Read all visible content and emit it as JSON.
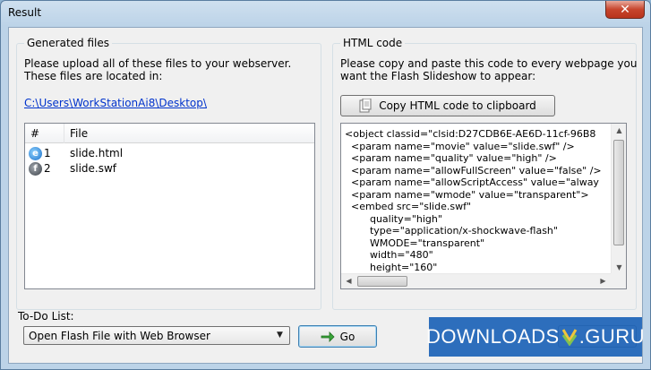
{
  "window": {
    "title": "Result",
    "close_glyph": "✕"
  },
  "generated_files": {
    "group_label": "Generated files",
    "instruction_line1": "Please upload all of these files to your webserver.",
    "instruction_line2": "These files are located in:",
    "path_link": "C:\\Users\\WorkStationAi8\\Desktop\\",
    "columns": [
      "#",
      "File"
    ],
    "rows": [
      {
        "num": "1",
        "file": "slide.html",
        "icon": "ie-icon"
      },
      {
        "num": "2",
        "file": "slide.swf",
        "icon": "flash-icon"
      }
    ]
  },
  "html_code": {
    "group_label": "HTML code",
    "instruction_line1": "Please copy and paste this code to every webpage you",
    "instruction_line2": "want the Flash Slideshow to appear:",
    "copy_button_label": "Copy HTML code to clipboard",
    "code_lines": [
      "<object classid=\"clsid:D27CDB6E-AE6D-11cf-96B8",
      "  <param name=\"movie\" value=\"slide.swf\" />",
      "  <param name=\"quality\" value=\"high\" />",
      "  <param name=\"allowFullScreen\" value=\"false\" />",
      "  <param name=\"allowScriptAccess\" value=\"alway",
      "  <param name=\"wmode\" value=\"transparent\">",
      "  <embed src=\"slide.swf\"",
      "        quality=\"high\"",
      "        type=\"application/x-shockwave-flash\"",
      "        WMODE=\"transparent\"",
      "        width=\"480\"",
      "        height=\"160\""
    ]
  },
  "todo": {
    "label": "To-Do List:",
    "selected_option": "Open Flash File with Web Browser",
    "go_button_label": "Go"
  },
  "watermark": {
    "text_left": "DOWNLOADS",
    "text_right": ".GURU"
  },
  "colors": {
    "link": "#0033cc",
    "close_button": "#c7452d",
    "watermark_bg": "#1d63b8"
  }
}
